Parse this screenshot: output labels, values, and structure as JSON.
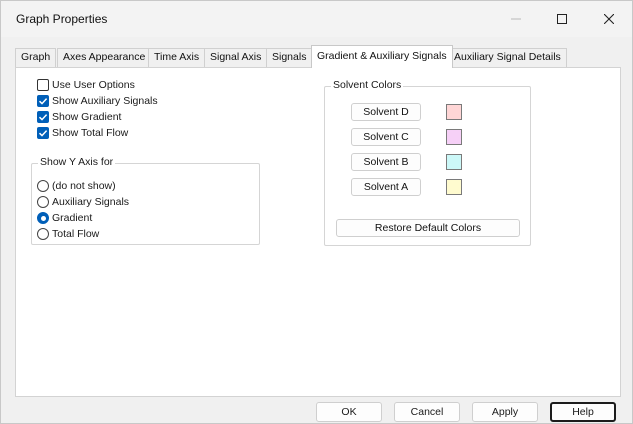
{
  "window": {
    "title": "Graph Properties"
  },
  "tabs": [
    "Graph",
    "Axes Appearance",
    "Time Axis",
    "Signal Axis",
    "Signals",
    "Gradient & Auxiliary Signals",
    "Auxiliary Signal Details"
  ],
  "options": {
    "use_user_options": {
      "label": "Use User Options",
      "checked": false
    },
    "show_aux_signals": {
      "label": "Show Auxiliary Signals",
      "checked": true
    },
    "show_gradient": {
      "label": "Show Gradient",
      "checked": true
    },
    "show_total_flow": {
      "label": "Show Total Flow",
      "checked": true
    }
  },
  "y_axis_group": {
    "title": "Show Y Axis for",
    "options": [
      "(do not show)",
      "Auxiliary Signals",
      "Gradient",
      "Total Flow"
    ],
    "selected": "Gradient"
  },
  "solvent_group": {
    "title": "Solvent Colors",
    "solvents": [
      {
        "label": "Solvent D",
        "color": "#ffd6d6"
      },
      {
        "label": "Solvent C",
        "color": "#f6d0f7"
      },
      {
        "label": "Solvent B",
        "color": "#ccf8f8"
      },
      {
        "label": "Solvent A",
        "color": "#fffbcf"
      }
    ],
    "restore_label": "Restore Default Colors"
  },
  "buttons": {
    "ok": "OK",
    "cancel": "Cancel",
    "apply": "Apply",
    "help": "Help"
  }
}
